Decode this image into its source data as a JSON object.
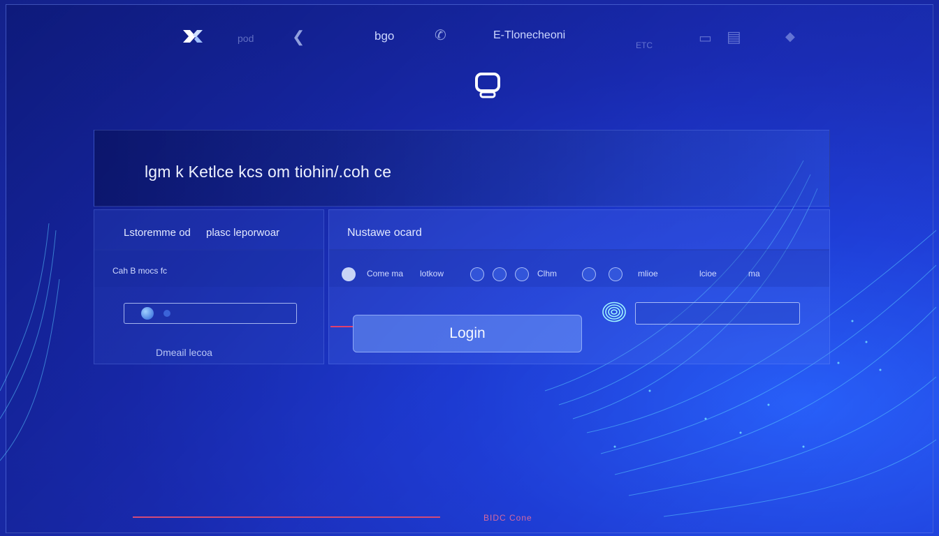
{
  "nav": {
    "item1": "pod",
    "item2": "bgo",
    "item3": "E-Tlonecheoni",
    "item4": "ETC"
  },
  "header": {
    "headline": "lgm k Ketlce kcs  om tiohin/.coh ce"
  },
  "left_panel": {
    "top_label_1": "Lstoremme od",
    "top_label_2": "plasc leporwoar",
    "mid_label": "Cah B mocs fc",
    "bottom_label": "Dmeail lecoa"
  },
  "right_panel": {
    "top_label": "Nustawe ocard",
    "options": {
      "opt1": "Come ma",
      "opt2": "lotkow",
      "opt3": "Clhm",
      "opt4": "mlioe",
      "opt5": "lcioe",
      "opt6": "ma"
    },
    "login_label": "Login"
  },
  "footer": {
    "text": "BIDC Cone"
  },
  "colors": {
    "accent": "#e0406e",
    "brand": "#1f3fd8"
  }
}
